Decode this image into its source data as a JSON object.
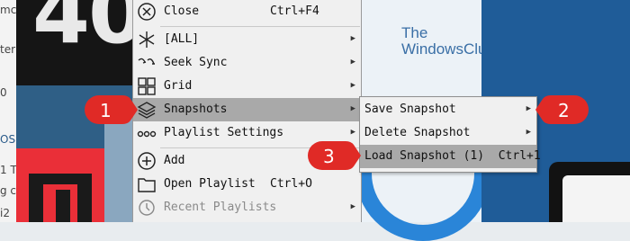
{
  "background": {
    "big_digits": "40",
    "logo_line1": "The",
    "logo_line2": "WindowsClub",
    "side_fragments": [
      "mc",
      "ter",
      "0",
      "OS",
      "1 T",
      "g ca",
      "i2"
    ]
  },
  "main_menu": {
    "items": [
      {
        "label": "Close",
        "shortcut": "Ctrl+F4",
        "icon": "close-circle-icon",
        "submenu": false
      },
      {
        "label": "[ALL]",
        "shortcut": "",
        "icon": "asterisk-icon",
        "submenu": true
      },
      {
        "label": "Seek Sync",
        "shortcut": "",
        "icon": "seek-sync-icon",
        "submenu": true
      },
      {
        "label": "Grid",
        "shortcut": "",
        "icon": "grid-icon",
        "submenu": true
      },
      {
        "label": "Snapshots",
        "shortcut": "",
        "icon": "layers-icon",
        "submenu": true
      },
      {
        "label": "Playlist Settings",
        "shortcut": "",
        "icon": "dots-icon",
        "submenu": true
      },
      {
        "label": "Add",
        "shortcut": "",
        "icon": "add-circle-icon",
        "submenu": false
      },
      {
        "label": "Open Playlist",
        "shortcut": "Ctrl+O",
        "icon": "folder-icon",
        "submenu": false
      },
      {
        "label": "Recent Playlists",
        "shortcut": "",
        "icon": "history-icon",
        "submenu": true
      }
    ]
  },
  "snapshots_submenu": {
    "items": [
      {
        "label": "Save Snapshot",
        "shortcut": "",
        "submenu": true
      },
      {
        "label": "Delete Snapshot",
        "shortcut": "",
        "submenu": true
      },
      {
        "label": "Load Snapshot (1)",
        "shortcut": "Ctrl+1",
        "submenu": false
      }
    ]
  },
  "callouts": [
    "1",
    "2",
    "3"
  ],
  "colors": {
    "callout": "#e02a26",
    "highlight": "#a9a9a9",
    "menu_bg": "#f0f0f0"
  }
}
